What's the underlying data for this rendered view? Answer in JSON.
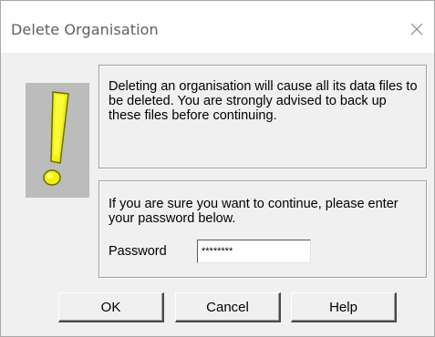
{
  "window": {
    "title": "Delete Organisation",
    "close_icon": "close-icon"
  },
  "warning": {
    "icon": "exclamation-warning-icon",
    "message": "Deleting an organisation will cause all its data files to be deleted. You are strongly advised to back up these files before continuing."
  },
  "confirm": {
    "prompt": "If you are sure you want to continue, please enter your password below.",
    "password_label": "Password",
    "password_value": "********"
  },
  "buttons": {
    "ok": "OK",
    "cancel": "Cancel",
    "help": "Help"
  },
  "colors": {
    "dialog_bg": "#f0f0f0",
    "icon_tile": "#bcbcbc",
    "icon_yellow": "#f3f300"
  }
}
